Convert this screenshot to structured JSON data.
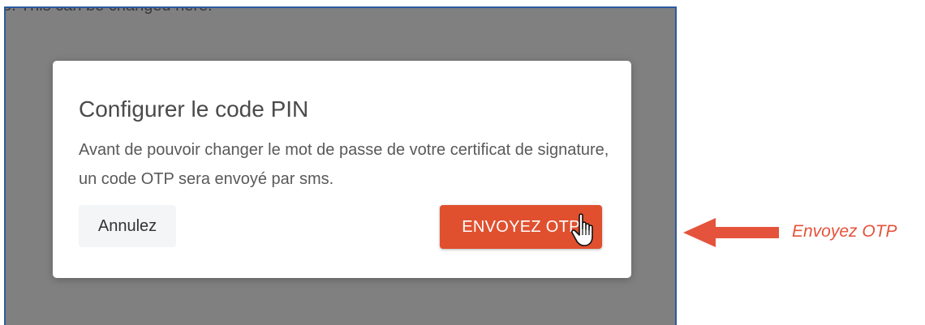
{
  "background_text": "b. This can be changed here.",
  "modal": {
    "title": "Configurer le code PIN",
    "body": "Avant de pouvoir changer le mot de passe de votre certificat de signature, un code OTP sera envoyé par sms.",
    "cancel_label": "Annulez",
    "send_otp_label": "ENVOYEZ OTP"
  },
  "annotation": {
    "label": "Envoyez OTP"
  },
  "colors": {
    "overlay": "#808080",
    "frame_border": "#2c5aa0",
    "primary_button": "#e0502f",
    "annotation": "#e5533c"
  },
  "icons": {
    "cursor": "hand-pointer-icon",
    "arrow": "left-arrow-icon"
  }
}
